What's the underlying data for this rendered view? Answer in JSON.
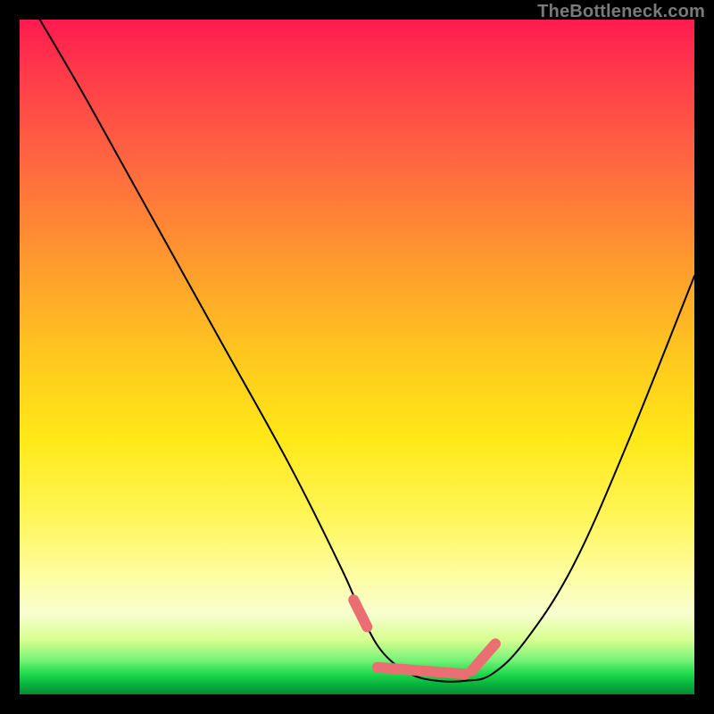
{
  "watermark": "TheBottleneck.com",
  "chart_data": {
    "type": "line",
    "title": "",
    "xlabel": "",
    "ylabel": "",
    "xlim": [
      0,
      100
    ],
    "ylim": [
      0,
      100
    ],
    "series": [
      {
        "name": "black-curve",
        "color": "#000000",
        "stroke_width": 2,
        "x": [
          3,
          10,
          20,
          30,
          40,
          48,
          51,
          54,
          58,
          62,
          66,
          70,
          75,
          82,
          90,
          100
        ],
        "y": [
          100,
          88,
          70,
          52,
          34,
          18,
          11,
          6,
          3,
          2,
          2,
          3,
          8,
          19,
          37,
          62
        ]
      },
      {
        "name": "pink-overlay",
        "color": "#e96f72",
        "stroke_width": 12,
        "segments": [
          {
            "x": [
              49.5,
              51.5
            ],
            "y": [
              14,
              10
            ]
          },
          {
            "x": [
              53,
              66
            ],
            "y": [
              4,
              3
            ]
          },
          {
            "x": [
              67,
              70.5
            ],
            "y": [
              3.5,
              7.5
            ]
          }
        ]
      }
    ],
    "gradient_stops": [
      {
        "pos": 0,
        "color": "#ff1a4f"
      },
      {
        "pos": 0.5,
        "color": "#ffc81e"
      },
      {
        "pos": 0.88,
        "color": "#f8ffd0"
      },
      {
        "pos": 0.97,
        "color": "#1ed94d"
      },
      {
        "pos": 1.0,
        "color": "#068a33"
      }
    ]
  }
}
